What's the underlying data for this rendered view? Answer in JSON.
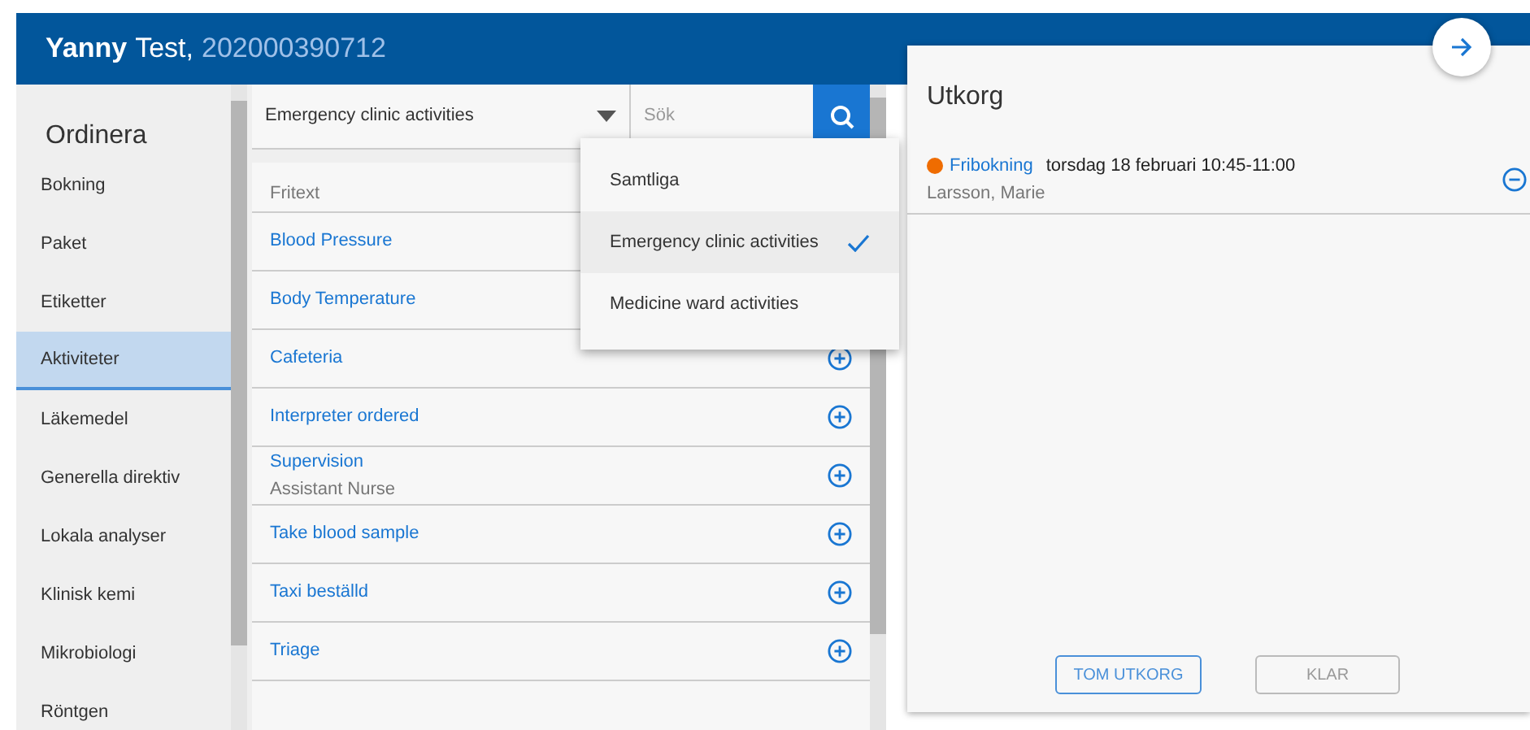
{
  "header": {
    "first_name": "Yanny",
    "last_name": "Test,",
    "id_number": "202000390712"
  },
  "sidebar": {
    "title": "Ordinera",
    "items": [
      {
        "label": "Bokning",
        "selected": false
      },
      {
        "label": "Paket",
        "selected": false
      },
      {
        "label": "Etiketter",
        "selected": false
      },
      {
        "label": "Aktiviteter",
        "selected": true
      },
      {
        "label": "Läkemedel",
        "selected": false
      },
      {
        "label": "Generella direktiv",
        "selected": false
      },
      {
        "label": "Lokala analyser",
        "selected": false
      },
      {
        "label": "Klinisk kemi",
        "selected": false
      },
      {
        "label": "Mikrobiologi",
        "selected": false
      },
      {
        "label": "Röntgen",
        "selected": false
      }
    ]
  },
  "filter": {
    "value": "Emergency clinic activities",
    "search_placeholder": "Sök"
  },
  "freetext": {
    "placeholder": "Fritext"
  },
  "activities": [
    {
      "name": "Blood Pressure"
    },
    {
      "name": "Body Temperature"
    },
    {
      "name": "Cafeteria"
    },
    {
      "name": "Interpreter ordered"
    },
    {
      "name": "Supervision",
      "subtitle": "Assistant Nurse"
    },
    {
      "name": "Take blood sample"
    },
    {
      "name": "Taxi beställd"
    },
    {
      "name": "Triage"
    }
  ],
  "dropdown": {
    "options": [
      {
        "label": "Samtliga",
        "selected": false
      },
      {
        "label": "Emergency clinic activities",
        "selected": true
      },
      {
        "label": "Medicine ward activities",
        "selected": false
      }
    ]
  },
  "outbox": {
    "title": "Utkorg",
    "items": [
      {
        "type": "Fribokning",
        "color": "#ef6c00",
        "when": "torsdag 18 februari 10:45-11:00",
        "person": "Larsson, Marie"
      }
    ],
    "buttons": [
      {
        "label": "TOM UTKORG",
        "disabled": false
      },
      {
        "label": "KLAR",
        "disabled": true
      }
    ]
  }
}
